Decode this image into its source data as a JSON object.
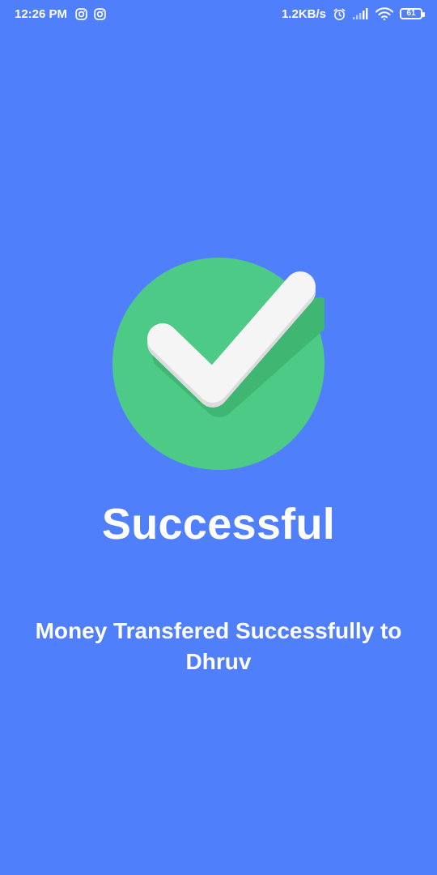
{
  "status_bar": {
    "time": "12:26 PM",
    "network_speed": "1.2KB/s",
    "battery_level": "61",
    "icons": [
      "instagram-icon",
      "instagram-icon",
      "alarm-icon",
      "signal-icon",
      "wifi-icon",
      "battery-icon"
    ]
  },
  "success": {
    "icon": "check-circle-icon",
    "title": "Successful",
    "message": "Money Transfered Successfully to Dhruv"
  },
  "colors": {
    "background": "#507ffc",
    "circle": "#4dcb86",
    "check": "#f5f5f5",
    "text": "#ffffff"
  }
}
